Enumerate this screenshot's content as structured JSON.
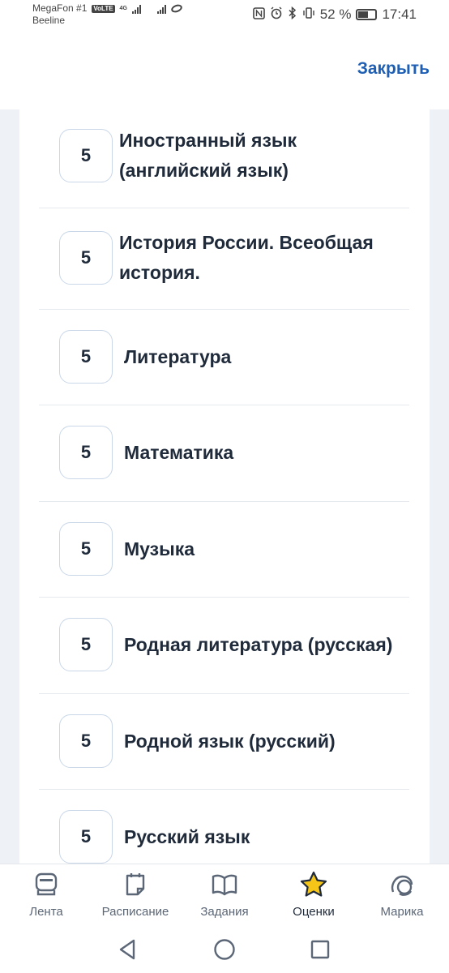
{
  "status_bar": {
    "carrier1": "MegaFon #1",
    "volte": "VoLTE",
    "network_type": "4G",
    "carrier2": "Beeline",
    "battery_percent": "52 %",
    "battery_level": 0.52,
    "time": "17:41"
  },
  "header": {
    "close_label": "Закрыть"
  },
  "subjects": [
    {
      "grade": "5",
      "name": "Иностранный язык (английский язык)"
    },
    {
      "grade": "5",
      "name": "История России. Всеобщая история."
    },
    {
      "grade": "5",
      "name": "Литература"
    },
    {
      "grade": "5",
      "name": "Математика"
    },
    {
      "grade": "5",
      "name": "Музыка"
    },
    {
      "grade": "5",
      "name": "Родная литература (русская)"
    },
    {
      "grade": "5",
      "name": "Родной язык (русский)"
    },
    {
      "grade": "5",
      "name": "Русский язык"
    }
  ],
  "bottom_nav": {
    "active": "grades",
    "accent_color": "#f5c518",
    "items": [
      {
        "id": "feed",
        "label": "Лента",
        "icon": "feed-icon"
      },
      {
        "id": "schedule",
        "label": "Расписание",
        "icon": "calendar-icon"
      },
      {
        "id": "tasks",
        "label": "Задания",
        "icon": "book-icon"
      },
      {
        "id": "grades",
        "label": "Оценки",
        "icon": "star-icon"
      },
      {
        "id": "marika",
        "label": "Марика",
        "icon": "assistant-icon"
      }
    ]
  },
  "colors": {
    "link": "#1e5fb4",
    "text": "#1f2a3a",
    "page_background": "#eef1f6",
    "grade_border": "#c9d7e8"
  }
}
